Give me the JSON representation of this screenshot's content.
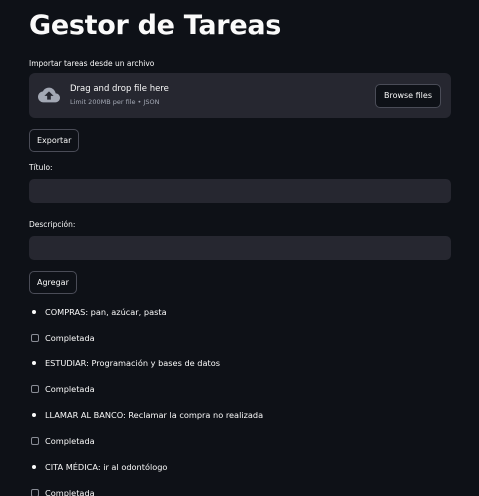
{
  "title": "Gestor de Tareas",
  "uploader": {
    "label": "Importar tareas desde un archivo",
    "drop_text": "Drag and drop file here",
    "limit_text": "Limit 200MB per file • JSON",
    "browse_label": "Browse files"
  },
  "export_label": "Exportar",
  "form": {
    "title_label": "Título:",
    "title_value": "",
    "description_label": "Descripción:",
    "description_value": "",
    "add_label": "Agregar"
  },
  "tasks": [
    {
      "text": "COMPRAS: pan, azúcar, pasta",
      "checkbox_label": "Completada",
      "checked": false
    },
    {
      "text": "ESTUDIAR: Programación y bases de datos",
      "checkbox_label": "Completada",
      "checked": false
    },
    {
      "text": "LLAMAR AL BANCO: Reclamar la compra no realizada",
      "checkbox_label": "Completada",
      "checked": false
    },
    {
      "text": "CITA MÉDICA: ir al odontólogo",
      "checkbox_label": "Completada",
      "checked": false
    }
  ],
  "icons": {
    "upload": "cloud-upload-icon"
  }
}
